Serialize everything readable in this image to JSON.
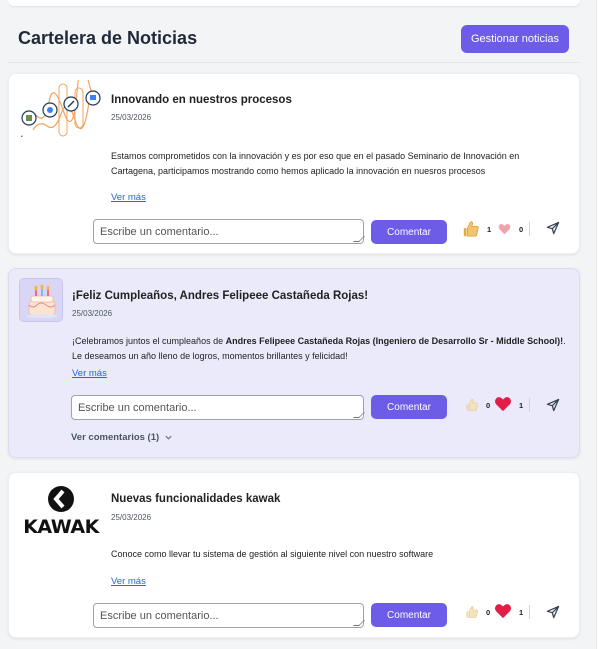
{
  "header": {
    "title": "Cartelera de Noticias",
    "manage_button": "Gestionar noticias"
  },
  "posts": [
    {
      "title": "Innovando en nuestros procesos",
      "date": "25/03/2026",
      "body": "Estamos comprometidos con la innovación y es por eso que en el pasado Seminario de Innovación en Cartagena, participamos mostrando como hemos aplicado la innovación en nuesros procesos",
      "see_more": "Ver más",
      "comment_placeholder": "Escribe un comentario...",
      "comment_button": "Comentar",
      "likes": "1",
      "hearts": "0",
      "icon": "innovation-illustration"
    },
    {
      "title": "¡Feliz Cumpleaños, Andres Felipeee Castañeda Rojas!",
      "date": "25/03/2026",
      "body_prefix": "¡Celebramos juntos el cumpleaños de ",
      "body_bold": "Andres Felipeee Castañeda Rojas (Ingeniero de Desarrollo Sr - Middle School)!",
      "body_suffix": ". Le deseamos un año lleno de logros, momentos brillantes y felicidad!",
      "see_more": "Ver más",
      "comment_placeholder": "Escribe un comentario...",
      "comment_button": "Comentar",
      "likes": "0",
      "hearts": "1",
      "view_comments": "Ver comentarios (1)",
      "icon": "cake-icon"
    },
    {
      "title": "Nuevas funcionalidades kawak",
      "date": "25/03/2026",
      "body": "Conoce como llevar tu sistema de gestión al siguiente nivel con nuestro software",
      "see_more": "Ver más",
      "comment_placeholder": "Escribe un comentario...",
      "comment_button": "Comentar",
      "likes": "0",
      "hearts": "1",
      "logo_text": "KAWAK",
      "icon": "kawak-logo"
    }
  ],
  "colors": {
    "accent": "#6d5ce8",
    "birthday_card": "#ebeafa",
    "link": "#2563eb",
    "heart": "#e11d48",
    "thumb": "#f2c46d"
  }
}
